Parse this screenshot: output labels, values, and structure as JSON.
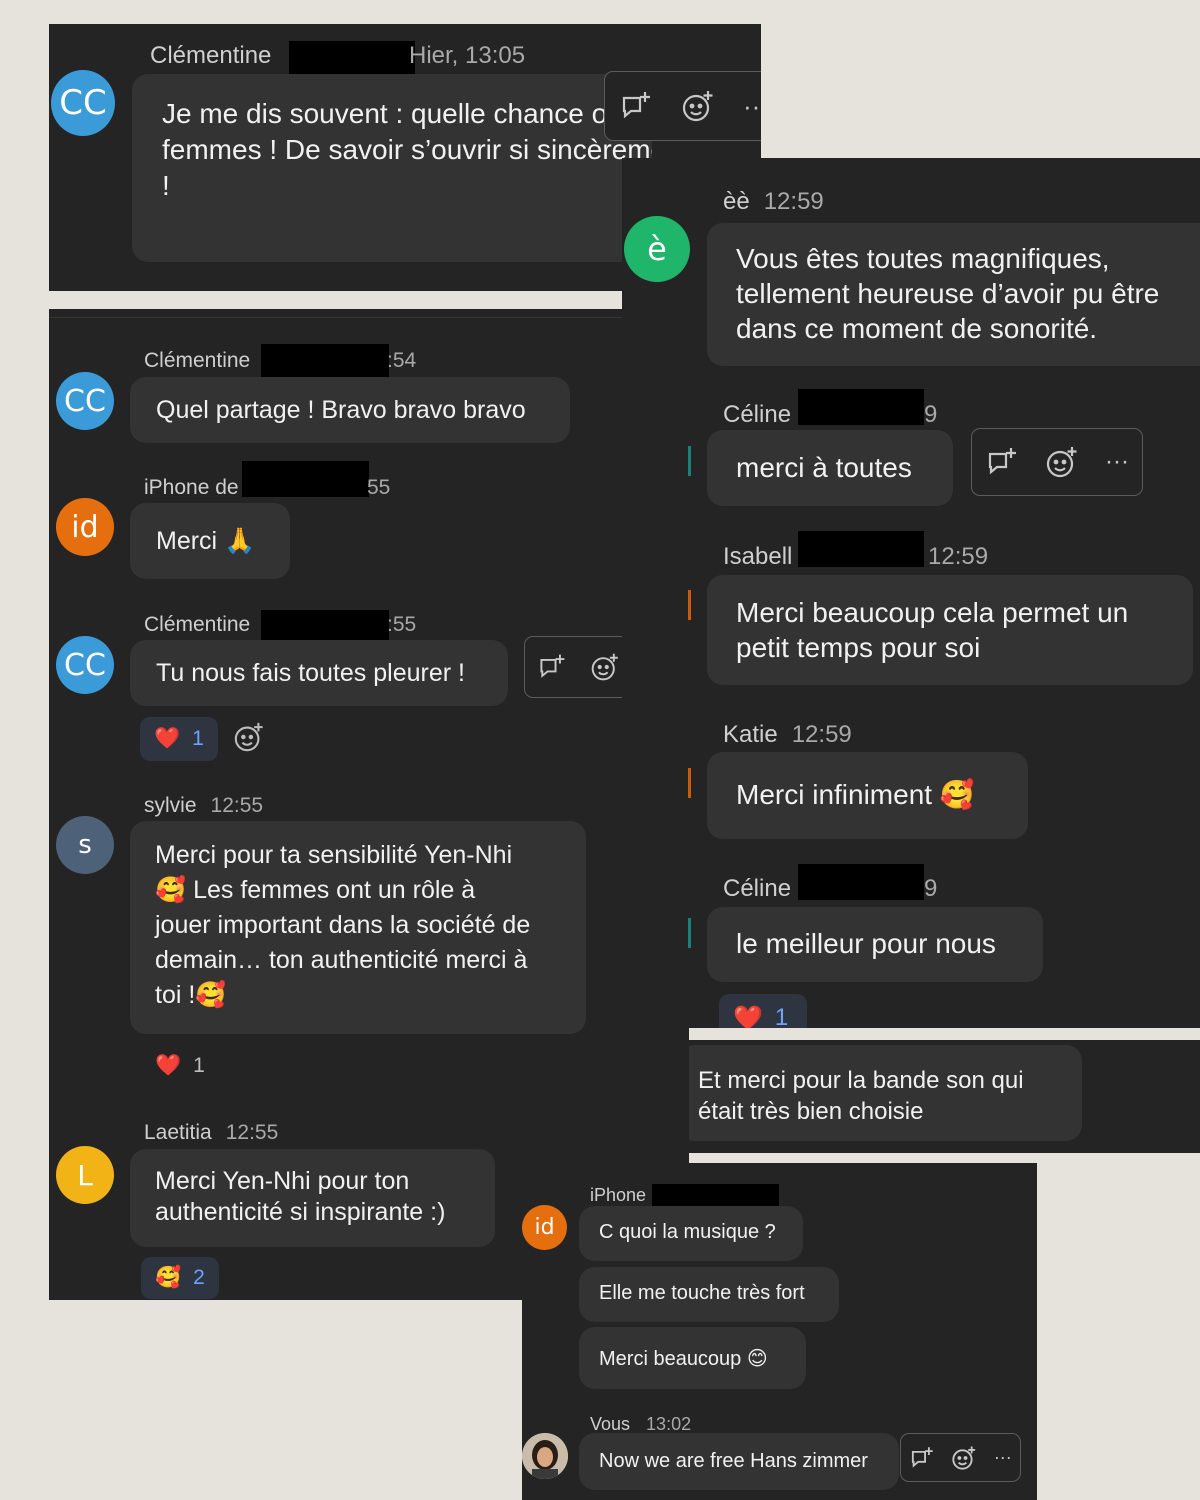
{
  "icons": {
    "reply": "reply-thread-icon",
    "emoji": "add-reaction-icon",
    "more": "more-options-icon",
    "heart": "red-heart-emoji",
    "pray": "folded-hands-emoji",
    "blush_hearts": "smiling-face-with-hearts-emoji",
    "smile": "smiling-face-emoji"
  },
  "colors": {
    "panel_bg": "#242424",
    "bubble_bg": "#333333",
    "page_bg": "#e6e3dc",
    "avatar_blue": "#3b9ad8",
    "avatar_orange": "#e56f0f",
    "avatar_green": "#1fb56b",
    "avatar_slate": "#4d6178",
    "avatar_yellow": "#f2b316",
    "reaction_count": "#6ba3ff"
  },
  "toolbar": {
    "more": "···"
  },
  "panel1": {
    "avatar": "CC",
    "sender": "Clémentine",
    "time": "Hier, 13:05",
    "message": "Je me dis souvent : quelle chance on a d’être des femmes ! De savoir s’ouvrir si sincèrement. Merci !"
  },
  "panel2": {
    "m1": {
      "avatar": "CC",
      "sender": "Clémentine",
      "time": ":54",
      "text": "Quel partage ! Bravo bravo bravo"
    },
    "m2": {
      "avatar": "id",
      "sender": "iPhone de",
      "time": "55",
      "text": "Merci 🙏"
    },
    "m3": {
      "avatar": "CC",
      "sender": "Clémentine",
      "time": ":55",
      "text": "Tu nous fais toutes pleurer !",
      "reaction_count": "1"
    },
    "m4": {
      "avatar": "s",
      "sender": "sylvie",
      "time": "12:55",
      "l1": "Merci pour ta sensibilité  Yen-Nhi",
      "l2": "🥰 Les femmes ont un rôle à",
      "l3": "jouer important dans la société de",
      "l4": "demain… ton authenticité merci à",
      "l5": "toi !🥰",
      "reaction_count": "1"
    },
    "m5": {
      "avatar": "L",
      "sender": "Laetitia",
      "time": "12:55",
      "text": "Merci Yen-Nhi pour ton authenticité si inspirante :)",
      "reaction_emoji": "🥰",
      "reaction_count": "2"
    }
  },
  "panel3": {
    "m1": {
      "avatar": "è",
      "sender": "èè",
      "time": "12:59",
      "text": "Vous êtes toutes magnifiques, tellement heureuse d’avoir pu être dans ce moment de sonorité."
    },
    "m2": {
      "sender": "Céline",
      "time": "9",
      "text": "merci à toutes"
    },
    "m3": {
      "sender": "Isabell",
      "time": "12:59",
      "text": "Merci beaucoup cela permet un petit temps pour soi"
    },
    "m4": {
      "sender": "Katie",
      "time": "12:59",
      "text": "Merci infiniment 🥰"
    },
    "m5": {
      "sender": "Céline",
      "time": "9",
      "text": "le meilleur pour nous",
      "reaction_count": "1"
    }
  },
  "panel4": {
    "text": "Et merci pour la bande son qui était très bien choisie"
  },
  "panel5": {
    "avatar": "id",
    "sender": "iPhone",
    "messages": [
      "C quoi la musique ?",
      "Elle me touche très fort",
      "Merci beaucoup 😊"
    ],
    "self": {
      "sender": "Vous",
      "time": "13:02",
      "text": "Now we are free Hans zimmer"
    }
  }
}
